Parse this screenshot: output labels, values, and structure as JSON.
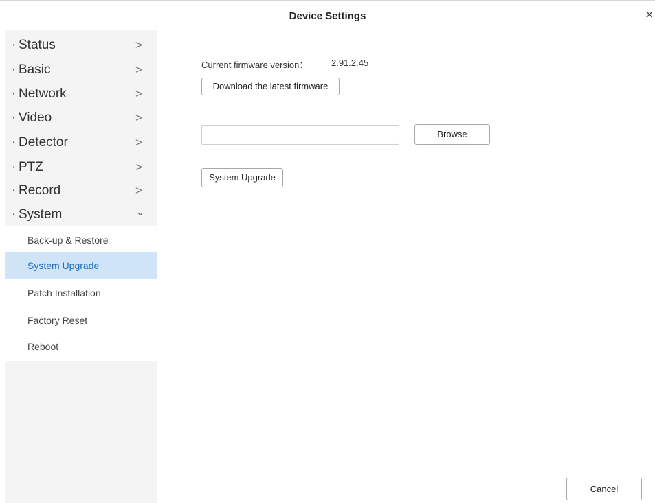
{
  "window": {
    "title": "Device Settings",
    "close_glyph": "×"
  },
  "sidebar": {
    "bullet": "·",
    "items": [
      {
        "label": "Status",
        "chevron": ">"
      },
      {
        "label": "Basic",
        "chevron": ">"
      },
      {
        "label": "Network",
        "chevron": ">"
      },
      {
        "label": "Video",
        "chevron": ">"
      },
      {
        "label": "Detector",
        "chevron": ">"
      },
      {
        "label": "PTZ",
        "chevron": ">"
      },
      {
        "label": "Record",
        "chevron": ">"
      },
      {
        "label": "System",
        "chevron": "⌄"
      }
    ],
    "system_subitems": [
      {
        "label": "Back-up & Restore"
      },
      {
        "label": "System Upgrade"
      },
      {
        "label": "Patch Installation"
      },
      {
        "label": "Factory Reset"
      },
      {
        "label": "Reboot"
      }
    ],
    "active_subitem": "System Upgrade"
  },
  "main": {
    "firmware_label": "Current firmware version：",
    "firmware_version": "2.91.2.45",
    "download_button": "Download the latest firmware",
    "file_path_value": "",
    "browse_button": "Browse",
    "upgrade_button": "System Upgrade"
  },
  "footer": {
    "cancel_button": "Cancel"
  },
  "colors": {
    "active_bg": "#cfe4f7",
    "active_text": "#1d6fb8",
    "sidebar_bg": "#f4f4f4"
  }
}
